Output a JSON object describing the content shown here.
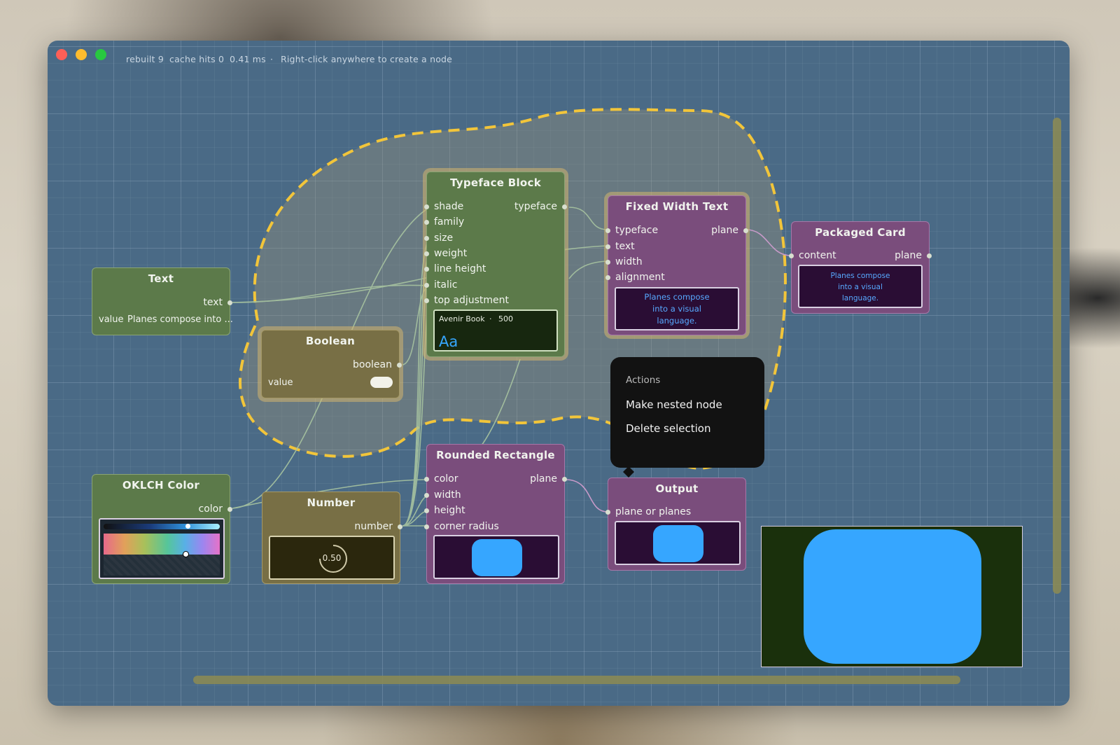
{
  "window": {
    "status_rebuilt": "rebuilt 9",
    "status_cache": "cache hits 0",
    "status_time": "0.41 ms",
    "status_sep": "·",
    "status_hint": "Right-click anywhere to create a node",
    "colors": {
      "close": "#ff5f57",
      "minimize": "#febc2e",
      "maximize": "#28c840",
      "canvas": "#4a6a86",
      "selection_outline": "#f2c53a"
    }
  },
  "nodes": {
    "text": {
      "title": "Text",
      "out_text": "text",
      "value_label": "value",
      "value": "Planes compose into ..."
    },
    "boolean": {
      "title": "Boolean",
      "out_boolean": "boolean",
      "value_label": "value",
      "value": true
    },
    "typeface": {
      "title": "Typeface Block",
      "in_shade": "shade",
      "in_family": "family",
      "in_size": "size",
      "in_weight": "weight",
      "in_line_height": "line height",
      "in_italic": "italic",
      "in_top_adjustment": "top adjustment",
      "out_typeface": "typeface",
      "preview_font": "Avenir Book",
      "preview_sep": "·",
      "preview_weight": "500",
      "preview_sample": "Aa"
    },
    "fixed_width_text": {
      "title": "Fixed Width Text",
      "in_typeface": "typeface",
      "in_text": "text",
      "in_width": "width",
      "in_alignment": "alignment",
      "out_plane": "plane",
      "preview_text": "Planes compose into a visual language."
    },
    "packaged_card": {
      "title": "Packaged Card",
      "in_content": "content",
      "out_plane": "plane",
      "preview_text": "Planes compose into a visual language."
    },
    "oklch": {
      "title": "OKLCH Color",
      "out_color": "color"
    },
    "number": {
      "title": "Number",
      "out_number": "number",
      "value": "0.50"
    },
    "rounded_rect": {
      "title": "Rounded Rectangle",
      "in_color": "color",
      "in_width": "width",
      "in_height": "height",
      "in_corner_radius": "corner radius",
      "out_plane": "plane",
      "fill": "#36a6ff"
    },
    "output": {
      "title": "Output",
      "in_plane": "plane or planes",
      "fill": "#36a6ff"
    }
  },
  "context_menu": {
    "header": "Actions",
    "items": [
      "Make nested node",
      "Delete selection"
    ]
  },
  "colors": {
    "accent_blue": "#36a6ff",
    "green_node": "#5c7a4a",
    "olive_node": "#786f45",
    "purple_node": "#7a4d7c"
  }
}
